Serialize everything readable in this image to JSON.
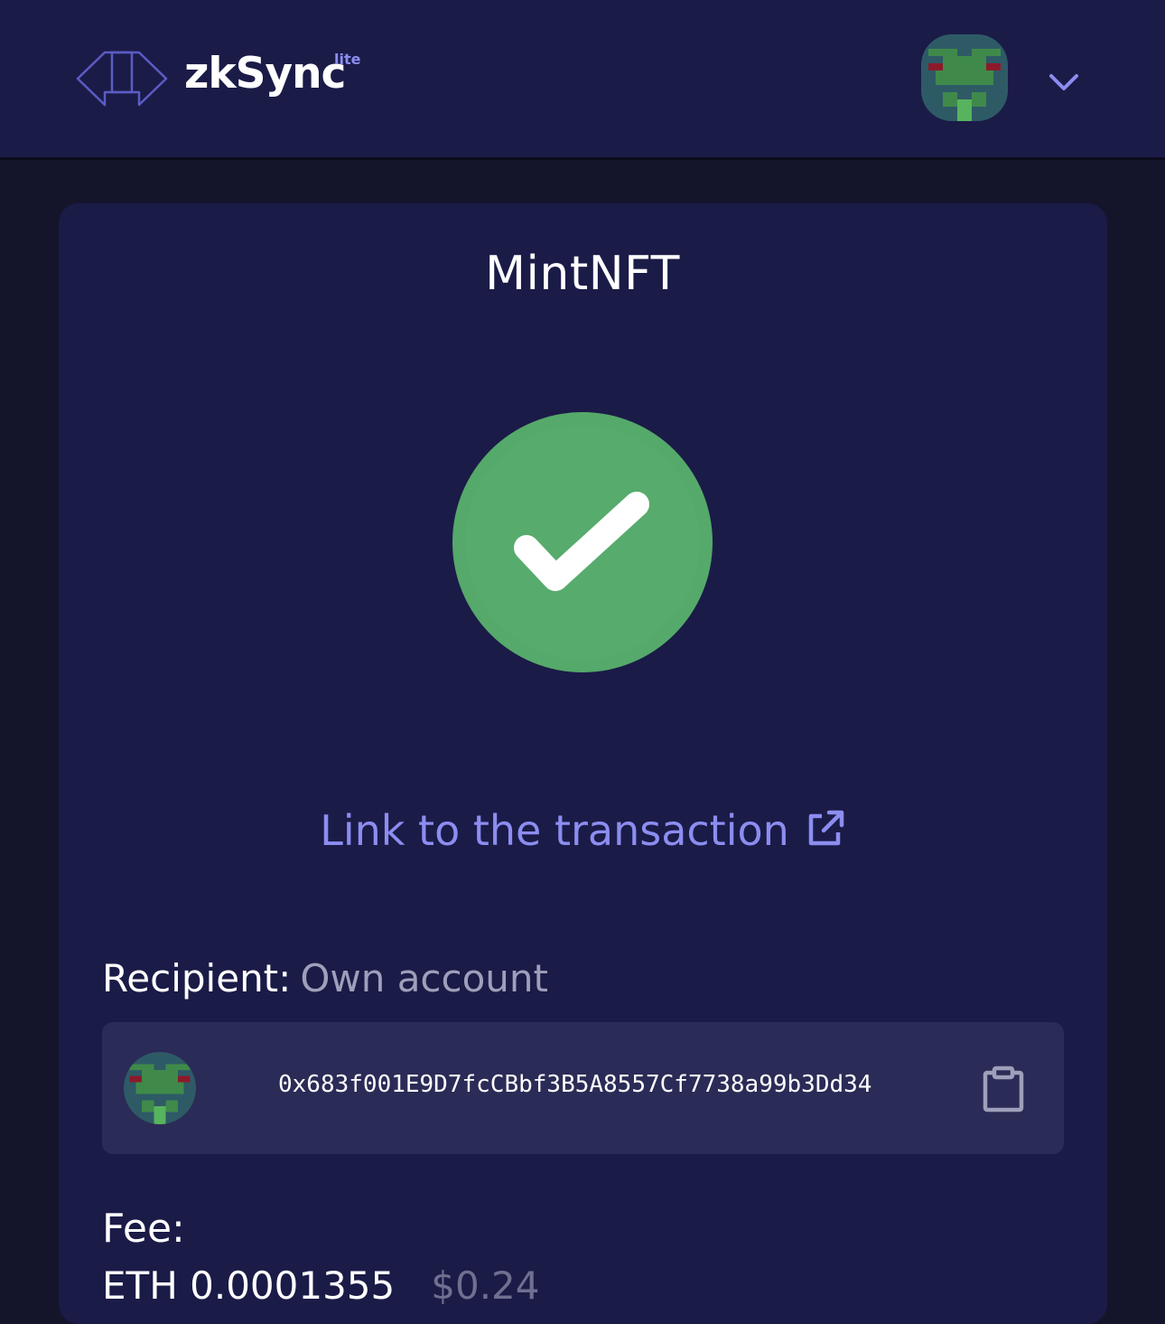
{
  "header": {
    "brand": "zkSync",
    "brand_badge": "lite",
    "account_icon": "pixel-avatar-icon",
    "menu_icon": "chevron-down-icon"
  },
  "main": {
    "title": "MintNFT",
    "status_icon": "check-circle-icon",
    "tx_link_label": "Link to the transaction",
    "tx_link_icon": "external-link-icon",
    "recipient_label": "Recipient:",
    "recipient_value": "Own account",
    "address": "0x683f001E9D7fcCBbf3B5A8557Cf7738a99b3Dd34",
    "copy_icon": "clipboard-icon",
    "fee_label": "Fee:",
    "fee_amount": "ETH 0.0001355",
    "fee_usd": "$0.24"
  },
  "colors": {
    "background": "#14152b",
    "surface": "#1b1b48",
    "accent": "#8c8df0",
    "success": "#55a96a",
    "muted": "#9e9fba"
  }
}
